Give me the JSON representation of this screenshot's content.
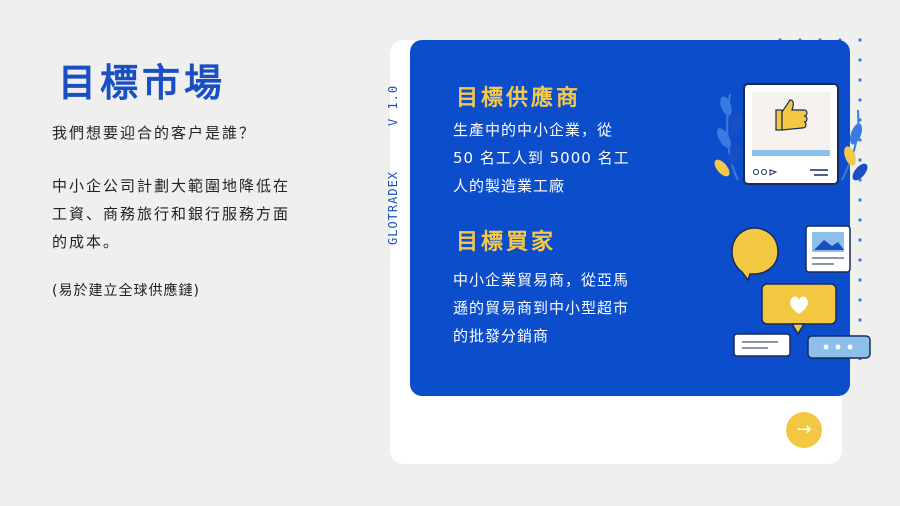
{
  "title": "目標市場",
  "subtitle": "我們想要迎合的客户是誰？",
  "paragraph": "中小企公司計劃大範圍地降低在工資、商務旅行和銀行服務方面的成本。",
  "note": "(易於建立全球供應鏈)",
  "vertical_label": {
    "brand": "GLOTRADEX",
    "version": "V 1.0"
  },
  "section1": {
    "heading": "目標供應商",
    "lines": [
      "生產中的中小企業，從",
      "50 名工人到 5000 名工",
      "人的製造業工廠"
    ]
  },
  "section2": {
    "heading": "目標買家",
    "lines": [
      "中小企業貿易商，從亞馬",
      "遜的貿易商到中小型超市",
      "的批發分銷商"
    ]
  },
  "colors": {
    "accent_blue": "#0c4dcb",
    "accent_yellow": "#f4c94a"
  },
  "icons": [
    "thumbs-up-post-icon",
    "speech-bubble-icon",
    "image-card-icon",
    "heart-bubble-icon",
    "message-bubble-icon",
    "ellipsis-bubble-icon",
    "arrow-right-icon"
  ]
}
